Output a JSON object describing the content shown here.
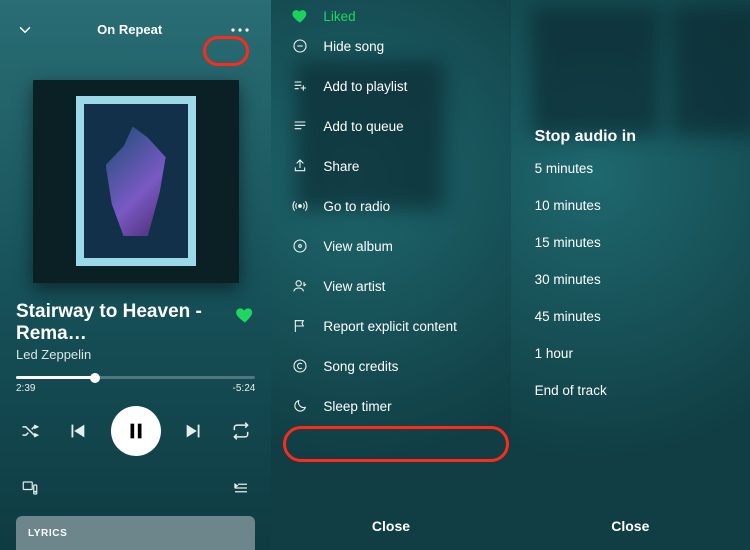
{
  "player": {
    "context": "On Repeat",
    "track": "Stairway to Heaven - Rema…",
    "artist": "Led Zeppelin",
    "elapsed": "2:39",
    "remaining": "-5:24",
    "lyrics_label": "LYRICS"
  },
  "context_menu": {
    "liked": "Liked",
    "items": [
      "Hide song",
      "Add to playlist",
      "Add to queue",
      "Share",
      "Go to radio",
      "View album",
      "View artist",
      "Report explicit content",
      "Song credits",
      "Sleep timer"
    ],
    "close": "Close"
  },
  "sleep_timer": {
    "title": "Stop audio in",
    "options": [
      "5 minutes",
      "10 minutes",
      "15 minutes",
      "30 minutes",
      "45 minutes",
      "1 hour",
      "End of track"
    ],
    "close": "Close"
  }
}
